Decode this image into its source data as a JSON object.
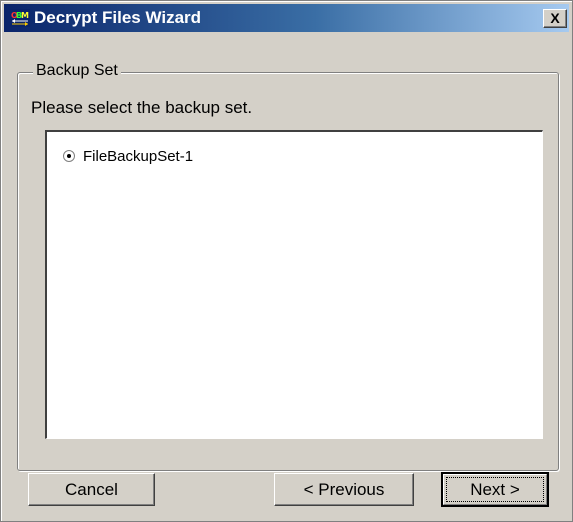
{
  "window": {
    "title": "Decrypt Files Wizard",
    "close_label": "X",
    "app_icon": "obm-app-icon"
  },
  "group": {
    "legend": "Backup Set",
    "instruction": "Please select the backup set."
  },
  "backup_sets": [
    {
      "label": "FileBackupSet-1",
      "selected": true
    }
  ],
  "buttons": {
    "cancel": "Cancel",
    "previous": "< Previous",
    "next": "Next >"
  },
  "colors": {
    "titlebar_start": "#0a246a",
    "titlebar_end": "#a6caf0",
    "dialog_face": "#d4d0c8"
  }
}
